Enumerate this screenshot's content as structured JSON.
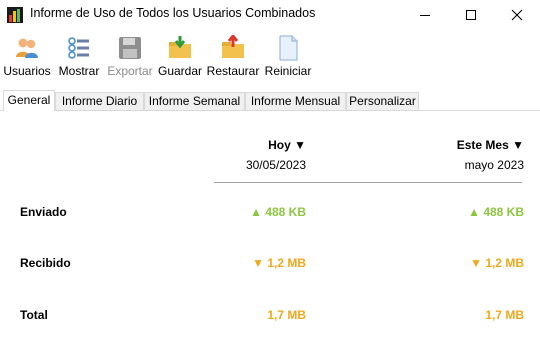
{
  "window": {
    "title": "Informe de Uso de Todos los Usuarios Combinados"
  },
  "toolbar": {
    "usuarios": "Usuarios",
    "mostrar": "Mostrar",
    "exportar": "Exportar",
    "guardar": "Guardar",
    "restaurar": "Restaurar",
    "reiniciar": "Reiniciar"
  },
  "tabs": [
    {
      "label": "General",
      "active": true
    },
    {
      "label": "Informe Diario"
    },
    {
      "label": "Informe Semanal"
    },
    {
      "label": "Informe Mensual"
    },
    {
      "label": "Personalizar"
    }
  ],
  "columns": {
    "today": {
      "header": "Hoy",
      "date": "30/05/2023"
    },
    "month": {
      "header": "Este Mes",
      "date": "mayo 2023"
    }
  },
  "rows": {
    "sent": {
      "label": "Enviado",
      "today": "488 KB",
      "month": "488 KB"
    },
    "received": {
      "label": "Recibido",
      "today": "1,2 MB",
      "month": "1,2 MB"
    },
    "total": {
      "label": "Total",
      "today": "1,7 MB",
      "month": "1,7 MB"
    }
  },
  "colors": {
    "up": "#8cc63f",
    "down": "#f0a81c",
    "accent_tab": "#ffffff"
  }
}
